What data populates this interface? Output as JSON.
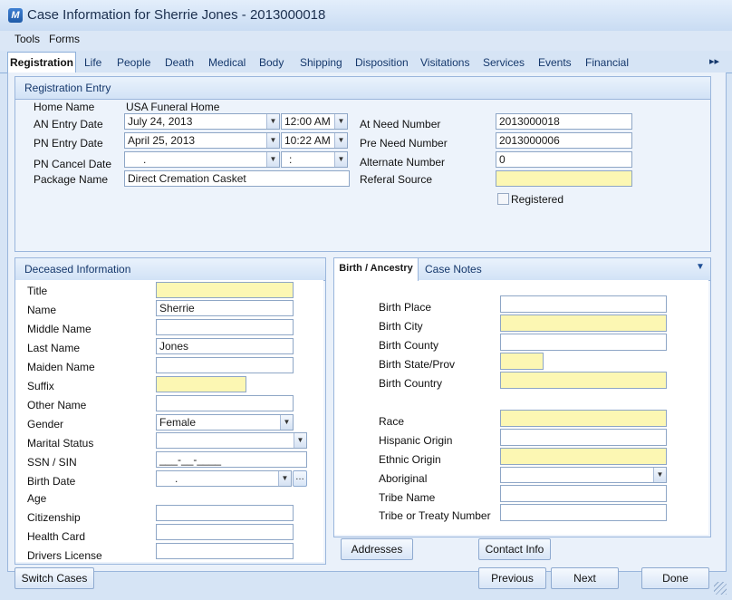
{
  "window": {
    "title": "Case Information for Sherrie Jones - 2013000018",
    "app_icon_letter": "M"
  },
  "menu": [
    "Tools",
    "Forms"
  ],
  "tabs": {
    "active": "Registration",
    "items": [
      "Life",
      "People",
      "Death",
      "Medical",
      "Body",
      "Shipping",
      "Disposition",
      "Visitations",
      "Services",
      "Events",
      "Financial"
    ],
    "more": "▸▸"
  },
  "registration": {
    "header": "Registration Entry",
    "home_name_label": "Home Name",
    "home_name_value": "USA Funeral Home",
    "an_entry_label": "AN Entry Date",
    "an_entry_date": "July  24, 2013",
    "an_entry_time": "12:00  AM",
    "pn_entry_label": "PN Entry Date",
    "pn_entry_date": "April  25, 2013",
    "pn_entry_time": "10:22  AM",
    "pn_cancel_label": "PN Cancel Date",
    "pn_cancel_date": ".",
    "pn_cancel_time": ":",
    "package_label": "Package Name",
    "package_value": "Direct Cremation Casket",
    "at_need_label": "At Need Number",
    "at_need_value": "2013000018",
    "pre_need_label": "Pre Need Number",
    "pre_need_value": "2013000006",
    "alternate_label": "Alternate Number",
    "alternate_value": "0",
    "referal_label": "Referal Source",
    "referal_value": "",
    "registered_label": "Registered"
  },
  "deceased": {
    "header": "Deceased Information",
    "title_label": "Title",
    "title_value": "",
    "name_label": "Name",
    "name_value": "Sherrie",
    "middle_label": "Middle Name",
    "middle_value": "",
    "last_label": "Last Name",
    "last_value": "Jones",
    "maiden_label": "Maiden Name",
    "maiden_value": "",
    "suffix_label": "Suffix",
    "suffix_value": "",
    "other_label": "Other Name",
    "other_value": "",
    "gender_label": "Gender",
    "gender_value": "Female",
    "marital_label": "Marital Status",
    "marital_value": "",
    "ssn_label": "SSN / SIN",
    "ssn_value": "___-__-____",
    "birth_date_label": "Birth Date",
    "birth_date_value": ".",
    "age_label": "Age",
    "citizenship_label": "Citizenship",
    "health_label": "Health Card",
    "drivers_label": "Drivers License"
  },
  "ancestry": {
    "tab_active": "Birth / Ancestry",
    "tab_other": "Case Notes",
    "birth_place_label": "Birth Place",
    "birth_city_label": "Birth City",
    "birth_county_label": "Birth County",
    "birth_state_label": "Birth State/Prov",
    "birth_country_label": "Birth Country",
    "race_label": "Race",
    "hispanic_label": "Hispanic Origin",
    "ethnic_label": "Ethnic Origin",
    "aboriginal_label": "Aboriginal",
    "tribe_label": "Tribe Name",
    "treaty_label": "Tribe or Treaty Number"
  },
  "buttons": {
    "addresses": "Addresses",
    "contact": "Contact Info",
    "switch": "Switch Cases",
    "previous": "Previous",
    "next": "Next",
    "done": "Done"
  }
}
